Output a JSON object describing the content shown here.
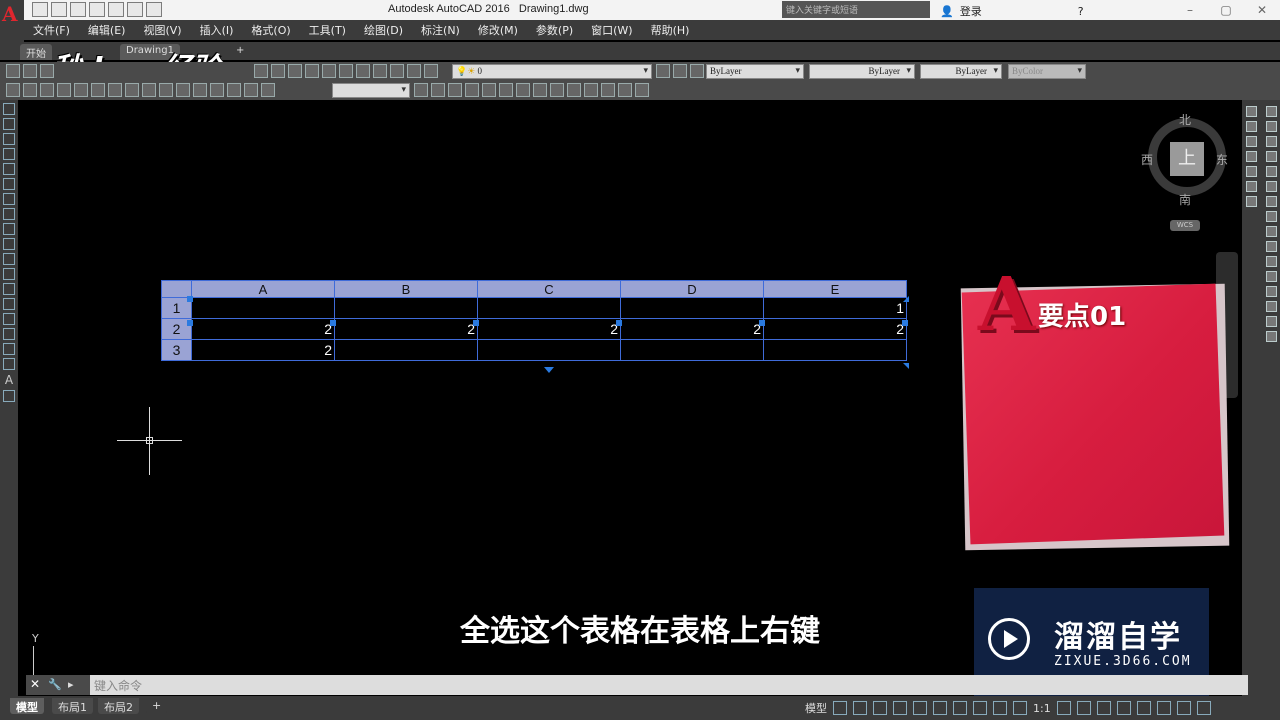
{
  "titlebar": {
    "app_name": "Autodesk AutoCAD 2016",
    "file_name": "Drawing1.dwg",
    "search_placeholder": "键入关键字或短语",
    "login_label": "登录",
    "app_logo": "A"
  },
  "menu": [
    "文件(F)",
    "编辑(E)",
    "视图(V)",
    "插入(I)",
    "格式(O)",
    "工具(T)",
    "绘图(D)",
    "标注(N)",
    "修改(M)",
    "参数(P)",
    "窗口(W)",
    "帮助(H)"
  ],
  "tabs": {
    "start": "开始",
    "drawing": "Drawing1",
    "add": "+"
  },
  "watermark_top": "秒dong经验",
  "toolbar": {
    "layer_value": "0",
    "color": "ByLayer",
    "linetype": "ByLayer",
    "lineweight": "ByLayer",
    "plotstyle": "ByColor"
  },
  "viewcube": {
    "north": "北",
    "south": "南",
    "east": "东",
    "west": "西",
    "face": "上",
    "wcs": "WCS"
  },
  "table": {
    "column_headers": [
      "A",
      "B",
      "C",
      "D",
      "E"
    ],
    "rows": [
      {
        "label": "1",
        "cells": [
          "",
          "",
          "",
          "",
          "1"
        ]
      },
      {
        "label": "2",
        "cells": [
          "2",
          "2",
          "2",
          "2",
          "2"
        ]
      },
      {
        "label": "3",
        "cells": [
          "2",
          "",
          "",
          "",
          ""
        ]
      }
    ]
  },
  "ucs": {
    "y_label": "Y"
  },
  "card": {
    "logo_letter": "A",
    "title": "要点01"
  },
  "subtitle": "全选这个表格在表格上右键",
  "zixue": {
    "name": "溜溜自学",
    "url": "ZIXUE.3D66.COM"
  },
  "command": {
    "placeholder": "键入命令",
    "close": "✕"
  },
  "statusbar": {
    "tabs": [
      "模型",
      "布局1",
      "布局2"
    ],
    "model_label": "模型",
    "scale": "1:1"
  }
}
